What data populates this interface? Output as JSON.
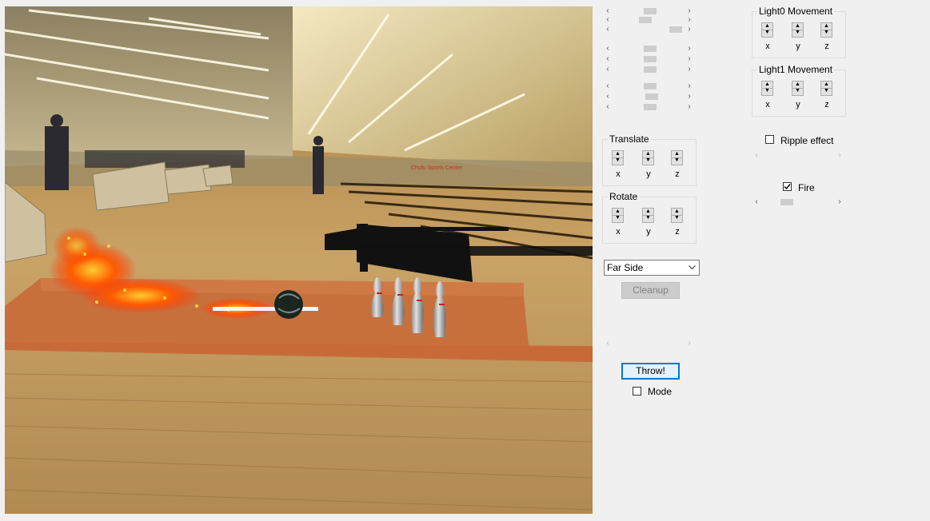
{
  "scene": {
    "signage_text": "Chofu Sports Center"
  },
  "controls": {
    "translate": {
      "label": "Translate",
      "axes": [
        "x",
        "y",
        "z"
      ]
    },
    "rotate": {
      "label": "Rotate",
      "axes": [
        "x",
        "y",
        "z"
      ]
    },
    "view_select": {
      "value": "Far Side"
    },
    "cleanup_button": {
      "label": "Cleanup",
      "enabled": false
    },
    "throw_button": {
      "label": "Throw!"
    },
    "mode_checkbox": {
      "label": "Mode",
      "checked": false
    },
    "light0": {
      "label": "Light0 Movement",
      "axes": [
        "x",
        "y",
        "z"
      ]
    },
    "light1": {
      "label": "Light1 Movement",
      "axes": [
        "x",
        "y",
        "z"
      ]
    },
    "ripple_checkbox": {
      "label": "Ripple effect",
      "checked": false
    },
    "fire_checkbox": {
      "label": "Fire",
      "checked": true
    }
  },
  "icons": {
    "scroll_left": "chevron-left-icon",
    "scroll_right": "chevron-right-icon",
    "spin_up": "triangle-up-icon",
    "spin_down": "triangle-down-icon",
    "dropdown": "chevron-down-icon",
    "check": "checkmark-icon"
  },
  "colors": {
    "window_bg": "#f0f0f0",
    "lane_orange": "#c8703c",
    "fire": "#ff4a00",
    "button_focus": "#0078d7"
  }
}
